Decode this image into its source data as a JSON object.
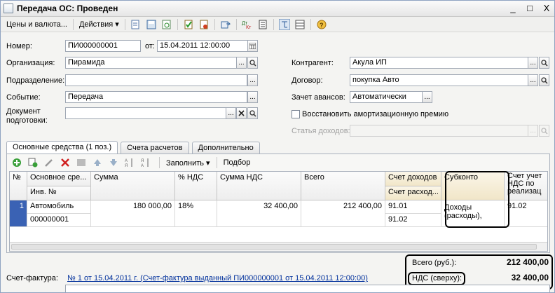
{
  "window": {
    "title": "Передача ОС: Проведен",
    "controls": [
      "_",
      "□",
      "X"
    ]
  },
  "toolbar": {
    "prices_label": "Цены и валюта...",
    "actions_label": "Действия ▾"
  },
  "form": {
    "number": {
      "label": "Номер:",
      "value": "ПИ000000001"
    },
    "date": {
      "label": "от:",
      "value": "15.04.2011 12:00:00"
    },
    "organization": {
      "label": "Организация:",
      "value": "Пирамида"
    },
    "department": {
      "label": "Подразделение:",
      "value": ""
    },
    "event": {
      "label": "Событие:",
      "value": "Передача"
    },
    "document": {
      "label1": "Документ",
      "label2": "подготовки:",
      "value": ""
    },
    "contractor": {
      "label": "Контрагент:",
      "value": "Акула ИП"
    },
    "contract": {
      "label": "Договор:",
      "value": "покупка Авто"
    },
    "advance": {
      "label": "Зачет авансов:",
      "value": "Автоматически"
    },
    "restore": {
      "label": "Восстановить амортизационную премию"
    },
    "income_item": {
      "label": "Статья доходов:",
      "value": ""
    }
  },
  "tabs": [
    "Основные средства (1 поз.)",
    "Счета расчетов",
    "Дополнительно"
  ],
  "table_toolbar": {
    "fill_label": "Заполнить ▾",
    "select_label": "Подбор"
  },
  "table": {
    "headers": {
      "n": "№",
      "asset": "Основное сре...",
      "inv": "Инв. №",
      "sum": "Сумма",
      "vat_rate": "% НДС",
      "vat_sum": "Сумма НДС",
      "total": "Всего",
      "income_acc": "Счет доходов",
      "expense_acc": "Счет расход...",
      "subconto": "Субконто",
      "vat_acc1": "Счет учет",
      "vat_acc2": "НДС по",
      "vat_acc3": "реализац"
    },
    "rows": [
      {
        "n": "1",
        "asset": "Автомобиль",
        "inv": "000000001",
        "sum": "180 000,00",
        "vat_rate": "18%",
        "vat_sum": "32 400,00",
        "total": "212 400,00",
        "income_acc": "91.01",
        "expense_acc": "91.02",
        "subconto1": "Доходы",
        "subconto2": "(расходы),",
        "vat_acc": "91.02"
      }
    ]
  },
  "totals": {
    "total_label": "Всего (руб.):",
    "total_value": "212 400,00",
    "vat_label": "НДС (сверху):",
    "vat_value": "32 400,00"
  },
  "invoice": {
    "label": "Счет-фактура:",
    "link": "№ 1 от 15.04.2011 г. (Счет-фактура выданный ПИ000000001 от 15.04.2011 12:00:00)"
  }
}
